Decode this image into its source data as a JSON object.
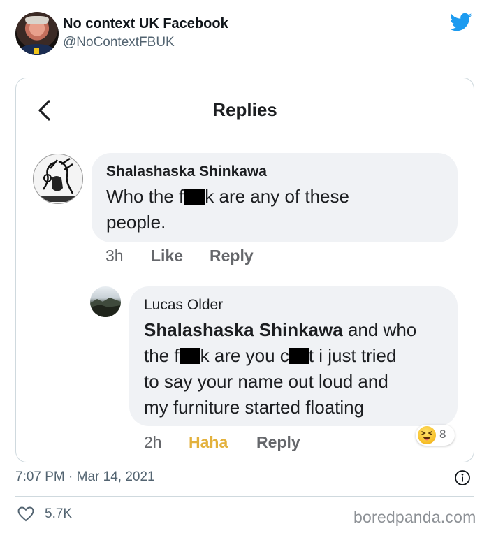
{
  "tweet": {
    "display_name": "No context UK Facebook",
    "handle": "@NoContextFBUK",
    "timestamp": "7:07 PM · Mar 14, 2021",
    "like_count": "5.7K",
    "icons": [
      "twitter-bird-icon",
      "info-icon",
      "heart-icon"
    ],
    "brand_color": "#1d9bf0"
  },
  "screenshot": {
    "title": "Replies",
    "comment": {
      "author": "Shalashaska Shinkawa",
      "text_line1_before": "Who the f",
      "text_line1_after": "k are any of these",
      "text_line2": "people.",
      "time": "3h",
      "like_label": "Like",
      "reply_label": "Reply"
    },
    "reply": {
      "author": "Lucas Older",
      "mention": "Shalashaska Shinkawa",
      "line1_after": " and who",
      "line2_a": "the f",
      "line2_b": "k are you c",
      "line2_c": "t i just tried",
      "line3": "to say your name out loud and",
      "line4": "my furniture started floating",
      "time": "2h",
      "reaction_label": "Haha",
      "reply_label": "Reply",
      "reaction_count": "8",
      "reaction_color": "#e3b13c"
    }
  },
  "watermark": "boredpanda.com"
}
